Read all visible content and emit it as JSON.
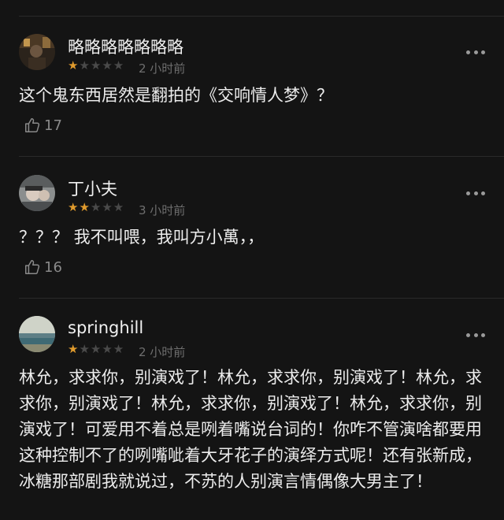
{
  "comments": [
    {
      "username": "略略略略略略略",
      "rating": 1,
      "stars_on": "★",
      "stars_off": "★★★★",
      "time": "2 小时前",
      "text": "这个鬼东西居然是翻拍的《交响情人梦》？",
      "likes": "17",
      "avatar_color": "#3a2e22"
    },
    {
      "username": "丁小夫",
      "rating": 2,
      "stars_on": "★★",
      "stars_off": "★★★",
      "time": "3 小时前",
      "text": "？？？ 我不叫喂，我叫方小萬，，",
      "likes": "16",
      "avatar_color": "#6b6f70"
    },
    {
      "username": "springhill",
      "rating": 1,
      "stars_on": "★",
      "stars_off": "★★★★",
      "time": "2 小时前",
      "text": "林允，求求你，别演戏了！林允，求求你，别演戏了！林允，求求你，别演戏了！林允，求求你，别演戏了！林允，求求你，别演戏了！可爱用不着总是咧着嘴说台词的！你咋不管演啥都要用这种控制不了的咧嘴呲着大牙花子的演绎方式呢！还有张新成，冰糖那部剧我就说过，不苏的人别演言情偶像大男主了！",
      "avatar_color": "#6f8a86"
    }
  ],
  "icons": {
    "more": "more-dots-icon",
    "like": "thumbs-up-icon"
  },
  "colors": {
    "background": "#141414",
    "star_active": "#e09b2d",
    "star_inactive": "#4a4a4a"
  }
}
